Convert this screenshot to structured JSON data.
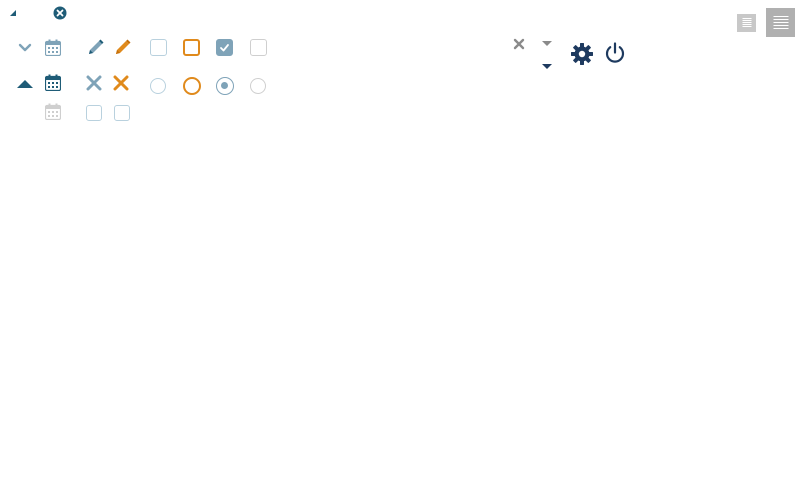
{
  "colors": {
    "primary": "#1f5c77",
    "muted": "#7fa3b8",
    "accent": "#e08a1c",
    "light": "#b9d1de",
    "disabled": "#cfcfcf",
    "navy": "#1e3a5f",
    "grey": "#8a8a8a",
    "hamburger_small": "#c8c8c8",
    "hamburger_large": "#b0b0b0"
  },
  "icons": {
    "collapse_small": "triangle-corner-icon",
    "clear_circle": "close-circle-icon",
    "chevron_down": "chevron-down-icon",
    "caret_up": "caret-up-icon",
    "calendar": "calendar-icon",
    "pencil": "pencil-icon",
    "close": "close-icon",
    "dropdown": "caret-down-icon",
    "settings": "gear-icon",
    "power": "power-icon",
    "menu": "hamburger-menu-icon"
  },
  "states": {
    "checkbox_default": "unchecked",
    "checkbox_focus": "unchecked",
    "checkbox_checked": "checked",
    "checkbox_disabled": "unchecked",
    "radio_default": "unselected",
    "radio_focus": "unselected",
    "radio_selected": "selected",
    "radio_disabled": "unselected"
  }
}
